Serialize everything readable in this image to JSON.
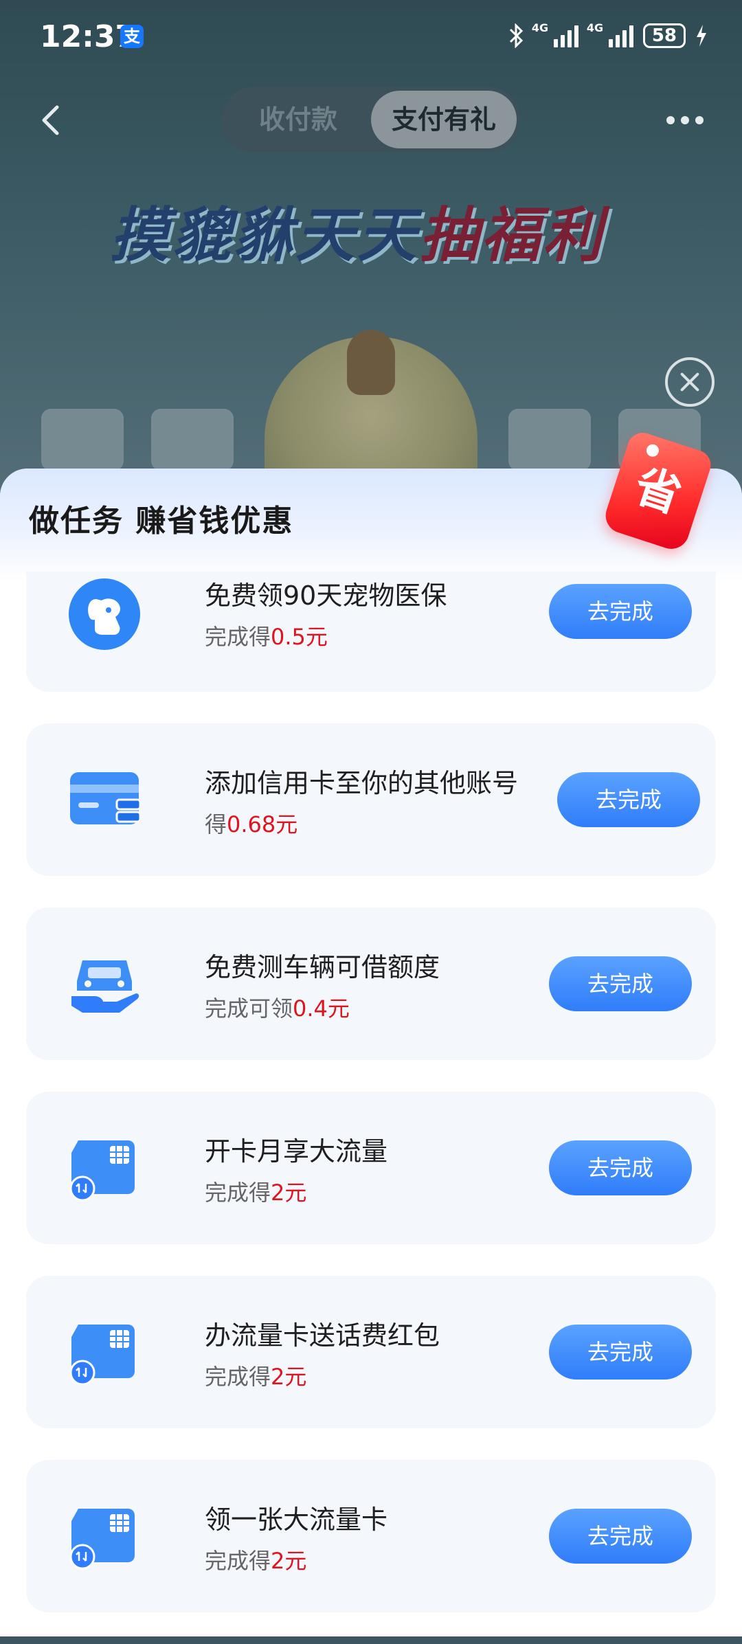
{
  "status_bar": {
    "time": "12:37",
    "alipay_badge": "支",
    "signal_1_label": "4G",
    "signal_2_label": "4G",
    "battery": "58"
  },
  "nav": {
    "tabs": [
      {
        "label": "收付款",
        "active": false
      },
      {
        "label": "支付有礼",
        "active": true
      }
    ]
  },
  "banner": {
    "title_part1": "摸貔貅天天",
    "title_part2": "抽福利"
  },
  "sheet": {
    "title": "做任务 赚省钱优惠",
    "tag": "省"
  },
  "tasks": [
    {
      "icon": "pet-insurance-icon",
      "title": "免费领90天宠物医保",
      "reward_prefix": "完成得",
      "reward_amount": "0.5元",
      "button": "去完成"
    },
    {
      "icon": "credit-card-icon",
      "title": "添加信用卡至你的其他账号",
      "reward_prefix": "得",
      "reward_amount": "0.68元",
      "button": "去完成"
    },
    {
      "icon": "car-loan-icon",
      "title": "免费测车辆可借额度",
      "reward_prefix": "完成可领",
      "reward_amount": "0.4元",
      "button": "去完成"
    },
    {
      "icon": "sim-card-icon",
      "title": "开卡月享大流量",
      "reward_prefix": "完成得",
      "reward_amount": "2元",
      "button": "去完成"
    },
    {
      "icon": "sim-card-icon",
      "title": "办流量卡送话费红包",
      "reward_prefix": "完成得",
      "reward_amount": "2元",
      "button": "去完成"
    },
    {
      "icon": "sim-card-icon",
      "title": "领一张大流量卡",
      "reward_prefix": "完成得",
      "reward_amount": "2元",
      "button": "去完成"
    }
  ],
  "colors": {
    "accent_blue": "#2f7dfa",
    "reward_red": "#e0141e",
    "card_bg": "#f4f7fc"
  }
}
